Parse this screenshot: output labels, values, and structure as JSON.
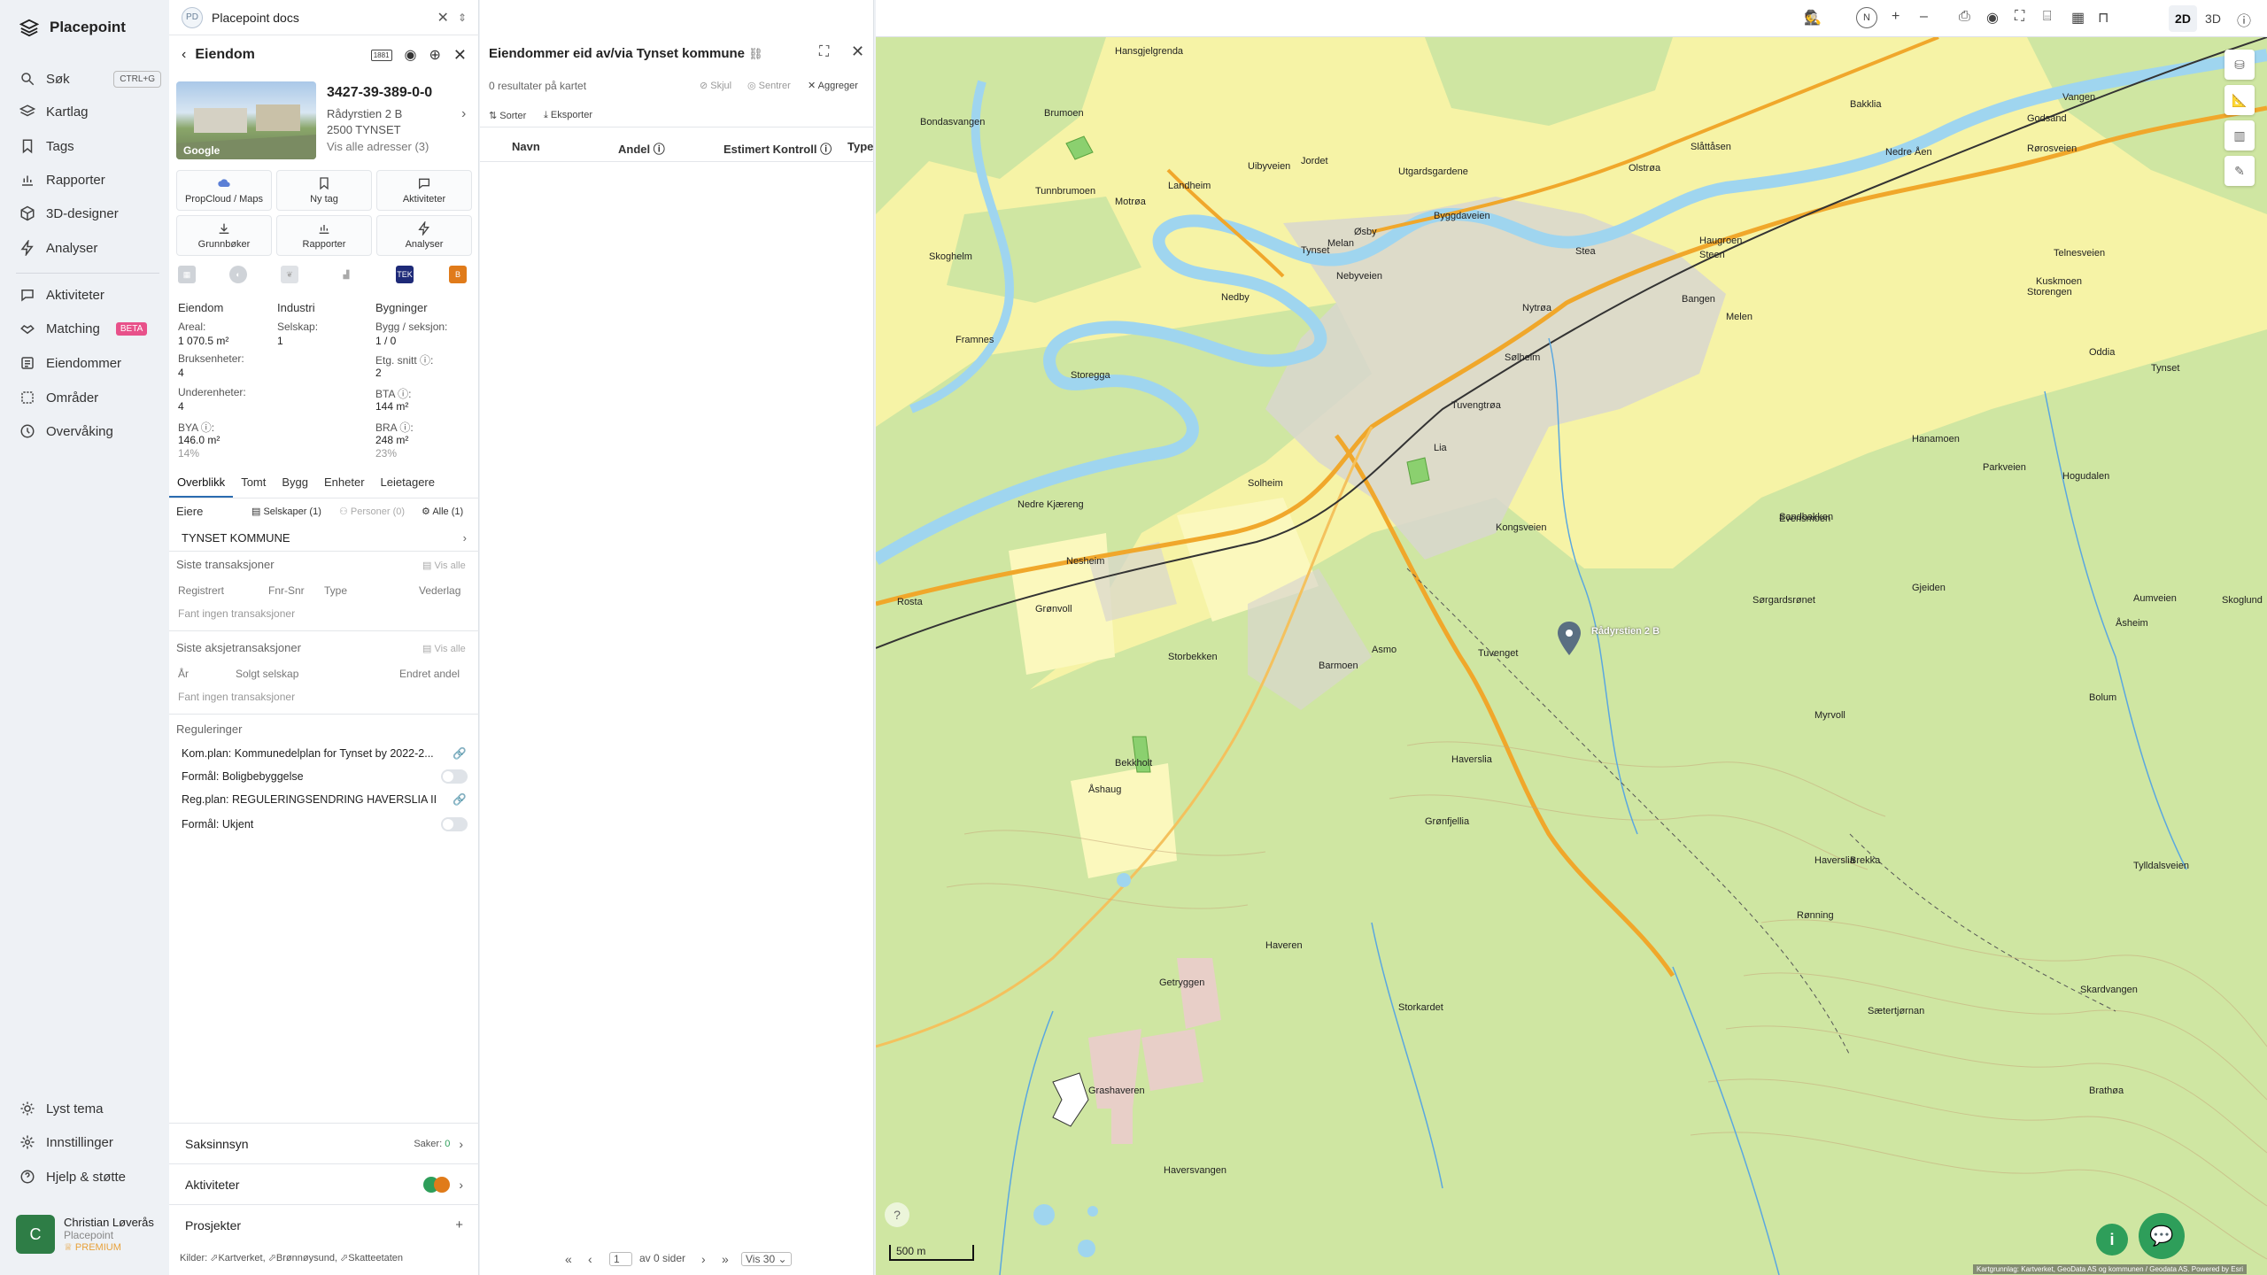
{
  "nav": {
    "brand": "Placepoint",
    "items": [
      {
        "label": "Søk",
        "shortcut": "CTRL+G"
      },
      {
        "label": "Kartlag"
      },
      {
        "label": "Tags"
      },
      {
        "label": "Rapporter"
      },
      {
        "label": "3D-designer"
      },
      {
        "label": "Analyser"
      },
      {
        "label": "Aktiviteter"
      },
      {
        "label": "Matching",
        "badge": "BETA"
      },
      {
        "label": "Eiendommer"
      },
      {
        "label": "Områder"
      },
      {
        "label": "Overvåking"
      }
    ],
    "bottom": [
      {
        "label": "Lyst tema"
      },
      {
        "label": "Innstillinger"
      },
      {
        "label": "Hjelp & støtte"
      }
    ],
    "user": {
      "initial": "C",
      "name": "Christian Løverås",
      "org": "Placepoint",
      "plan": "PREMIUM"
    }
  },
  "panel": {
    "workspace_badge": "PD",
    "workspace": "Placepoint docs",
    "title": "Eiendom",
    "badge_1881": "1881",
    "thumb_label": "Google",
    "id": "3427-39-389-0-0",
    "address": "Rådyrstien 2 B",
    "postal": "2500 TYNSET",
    "all_addresses": "Vis alle adresser (3)",
    "tiles": [
      "PropCloud / Maps",
      "Ny tag",
      "Aktiviteter",
      "Grunnbøker",
      "Rapporter",
      "Analyser"
    ],
    "badge_tek": "TEK",
    "badge_b": "B",
    "col1_head": "Eiendom",
    "col2_head": "Industri",
    "col3_head": "Bygninger",
    "areal_label": "Areal:",
    "areal_value": "1 070.5 m²",
    "selskap_label": "Selskap:",
    "selskap_value": "1",
    "bygg_label": "Bygg / seksjon:",
    "bygg_value": "1 / 0",
    "bruks_label": "Bruksenheter:",
    "bruks_value": "4",
    "etg_label": "Etg. snitt ⓘ:",
    "etg_value": "2",
    "under_label": "Underenheter:",
    "under_value": "4",
    "bta_label": "BTA ⓘ:",
    "bta_value": "144 m²",
    "bya_label": "BYA ⓘ:",
    "bya_value": "146.0 m²",
    "bya_pct": "14%",
    "bra_label": "BRA ⓘ:",
    "bra_value": "248 m²",
    "bra_pct": "23%",
    "tabs": [
      "Overblikk",
      "Tomt",
      "Bygg",
      "Enheter",
      "Leietagere"
    ],
    "eiere_label": "Eiere",
    "eiere_filters": [
      "Selskaper (1)",
      "Personer (0)",
      "Alle (1)"
    ],
    "owner": "TYNSET KOMMUNE",
    "trans_head": "Siste transaksjoner",
    "vis_alle": "Vis alle",
    "trans_cols": [
      "Registrert",
      "Fnr-Snr",
      "Type",
      "Vederlag"
    ],
    "no_trans": "Fant ingen transaksjoner",
    "aksje_head": "Siste aksjetransaksjoner",
    "aksje_cols": [
      "År",
      "Solgt selskap",
      "Endret andel"
    ],
    "regs_head": "Reguleringer",
    "regs": [
      "Kom.plan: Kommunedelplan for Tynset by 2022-2...",
      "Formål: Boligbebyggelse",
      "Reg.plan: REGULERINGSENDRING HAVERSLIA II",
      "Formål: Ukjent"
    ],
    "acc": [
      {
        "label": "Saksinnsyn",
        "meta": "Saker: ",
        "count": "0"
      },
      {
        "label": "Aktiviteter"
      },
      {
        "label": "Prosjekter"
      }
    ],
    "kilder": "Kilder: ⬀Kartverket, ⬀Brønnøysund, ⬀Skatteetaten"
  },
  "list": {
    "title": "Eiendommer eid av/via Tynset kommune",
    "results": "0 resultater på kartet",
    "actions": [
      "Skjul",
      "Sentrer",
      "Aggreger"
    ],
    "sort": "Sorter",
    "export": "Eksporter",
    "cols": [
      "Navn",
      "Andel ⓘ",
      "Estimert Kontroll ⓘ",
      "Type"
    ],
    "page_input": "1",
    "page_of": "av 0 sider",
    "vis": "Vis 30"
  },
  "map": {
    "mode_2d": "2D",
    "mode_3d": "3D",
    "scale": "500 m",
    "marker": "Rådyrstien 2 B",
    "attribution": "Kartgrunnlag: Kartverket, GeoData AS og kommunen / Geodata AS. Powered by Esri",
    "labels": [
      "Hansgjelgrenda",
      "Brumoen",
      "Bakklia",
      "Vangen",
      "Bondasvangen",
      "Landheim",
      "Uibyveien",
      "Jordet",
      "Rørosveien",
      "Godsand",
      "Motrøa",
      "Utgardsgardene",
      "Olstrøa",
      "Slåttåsen",
      "Nedre Åen",
      "Tunnbrumoen",
      "Byggdaveien",
      "Tynset",
      "Øsby",
      "Haugroen",
      "Nebyveien",
      "Melan",
      "Steen",
      "Telnesveien",
      "Skoghelm",
      "Stea",
      "Storengen",
      "Kuskmoen",
      "Nedby",
      "Nytrøa",
      "Melen",
      "Oddia",
      "Bangen",
      "Framnes",
      "Sølheim",
      "Storegga",
      "Tuvengtrøa",
      "Tynset",
      "Parkveien",
      "Hogudalen",
      "Lia",
      "Evensmoen",
      "Hanamoen",
      "Solheim",
      "Nedre Kjæreng",
      "Kongsveien",
      "Sandbakken",
      "Nesheim",
      "Aumveien",
      "Sørgardsrønet",
      "Åsheim",
      "Gjeiden",
      "Rosta",
      "Grønvoll",
      "Asmo",
      "Tuvenget",
      "Skoglund",
      "Storbekken",
      "Bolum",
      "Barmoen",
      "Myrvoll",
      "Haverslia",
      "Bekkholt",
      "Åshaug",
      "Haverslia",
      "Grønfjellia",
      "Brekka",
      "Rønning",
      "Tylldalsveien",
      "Haveren",
      "Skardvangen",
      "Getryggen",
      "Storkardet",
      "Sætertjørnan",
      "Brathøa",
      "Grashaveren",
      "Haversvangen"
    ]
  }
}
